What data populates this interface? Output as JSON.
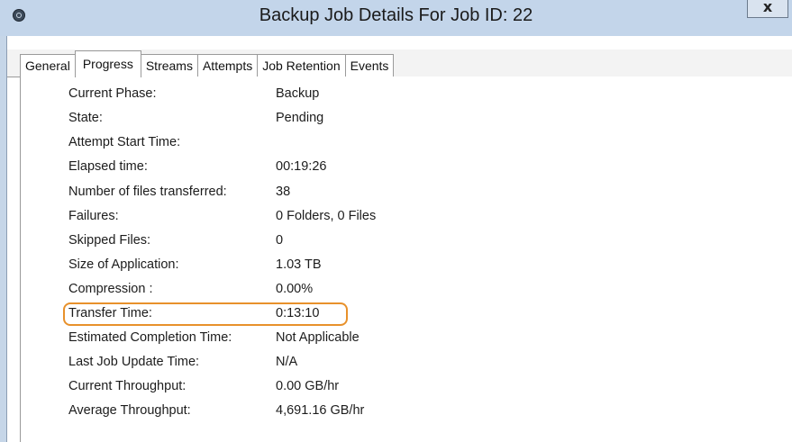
{
  "window": {
    "title": "Backup Job Details For Job ID: 22",
    "icon": "app-logo-icon",
    "close_label": "x"
  },
  "tabs": [
    {
      "label": "General",
      "active": false
    },
    {
      "label": "Progress",
      "active": true
    },
    {
      "label": "Streams",
      "active": false
    },
    {
      "label": "Attempts",
      "active": false
    },
    {
      "label": "Job Retention",
      "active": false
    },
    {
      "label": "Events",
      "active": false
    }
  ],
  "progress": {
    "rows": [
      {
        "label": "Current Phase:",
        "value": "Backup"
      },
      {
        "label": "State:",
        "value": "Pending"
      },
      {
        "label": "Attempt Start Time:",
        "value": ""
      },
      {
        "label": "Elapsed time:",
        "value": "00:19:26"
      },
      {
        "label": "Number of files transferred:",
        "value": "38"
      },
      {
        "label": "Failures:",
        "value": "0 Folders, 0 Files"
      },
      {
        "label": "Skipped Files:",
        "value": "0"
      },
      {
        "label": "Size of Application:",
        "value": "1.03 TB"
      },
      {
        "label": "Compression :",
        "value": "0.00%"
      },
      {
        "label": "Transfer Time:",
        "value": "0:13:10"
      },
      {
        "label": "Estimated Completion Time:",
        "value": "Not Applicable"
      },
      {
        "label": "Last Job Update Time:",
        "value": "N/A"
      },
      {
        "label": "Current Throughput:",
        "value": "0.00 GB/hr"
      },
      {
        "label": "Average Throughput:",
        "value": "4,691.16 GB/hr"
      }
    ],
    "highlighted_row": "Transfer Time:",
    "highlight_color": "#e8912b"
  }
}
